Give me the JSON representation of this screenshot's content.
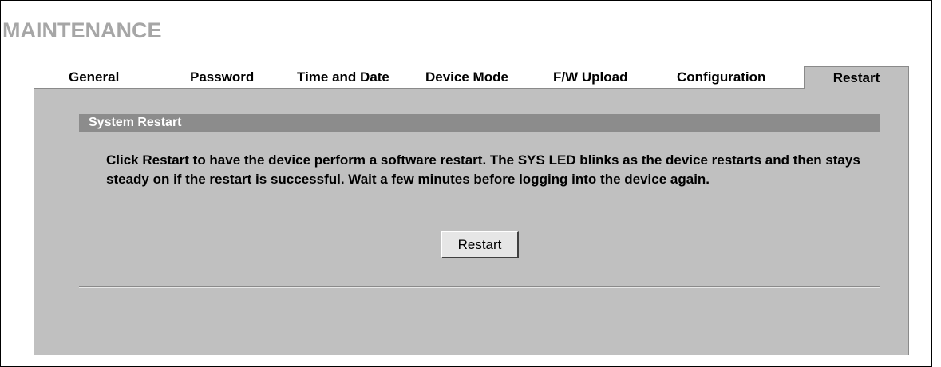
{
  "page": {
    "title": "MAINTENANCE"
  },
  "tabs": [
    {
      "label": "General",
      "active": false
    },
    {
      "label": "Password",
      "active": false
    },
    {
      "label": "Time and Date",
      "active": false
    },
    {
      "label": "Device Mode",
      "active": false
    },
    {
      "label": "F/W Upload",
      "active": false
    },
    {
      "label": "Configuration",
      "active": false
    },
    {
      "label": "Restart",
      "active": true
    }
  ],
  "section": {
    "header": "System Restart",
    "description": "Click Restart to have the device perform a software restart. The SYS LED blinks as the device restarts and then stays steady on if the restart is successful. Wait a few minutes before logging into the device again."
  },
  "actions": {
    "restart_label": "Restart"
  },
  "colors": {
    "panel_background": "#c0c0c0",
    "section_header_background": "#8c8c8c",
    "title_text": "#a6a6a6"
  }
}
